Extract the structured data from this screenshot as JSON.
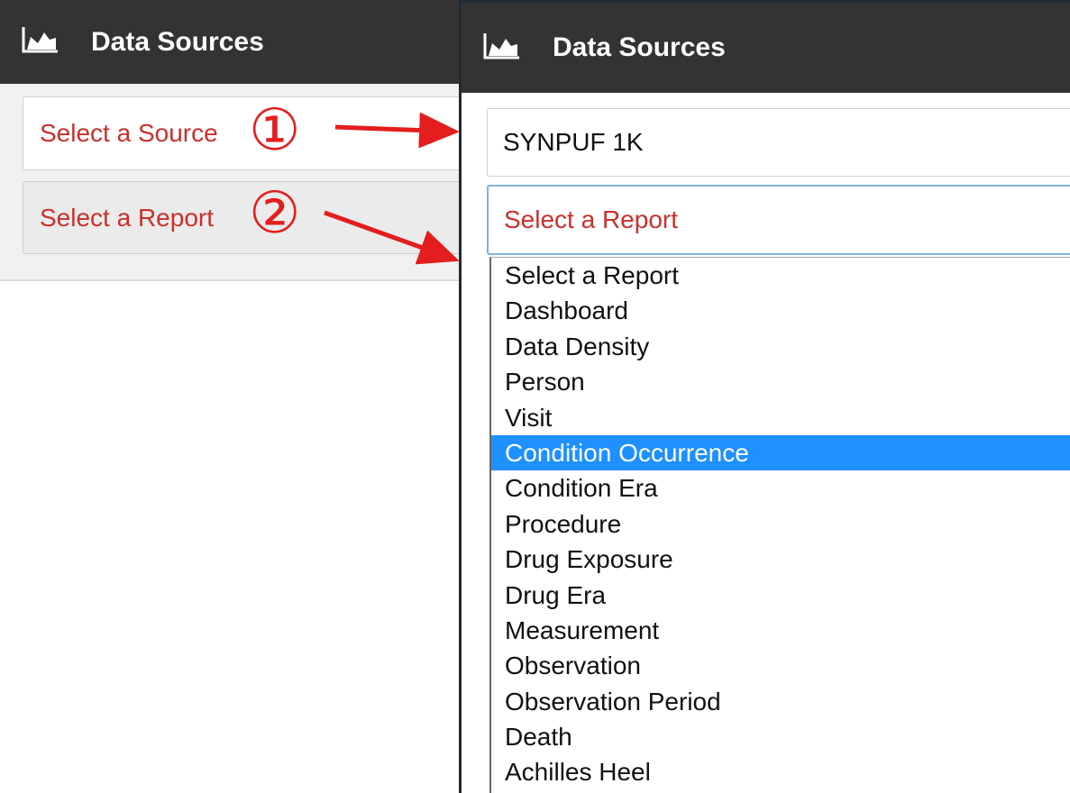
{
  "header": {
    "title": "Data Sources",
    "icon": "area-chart-icon"
  },
  "left": {
    "source_placeholder": "Select a Source",
    "report_placeholder": "Select a Report"
  },
  "right": {
    "source_value": "SYNPUF 1K",
    "report_placeholder": "Select a Report",
    "options": [
      "Select a Report",
      "Dashboard",
      "Data Density",
      "Person",
      "Visit",
      "Condition Occurrence",
      "Condition Era",
      "Procedure",
      "Drug Exposure",
      "Drug Era",
      "Measurement",
      "Observation",
      "Observation Period",
      "Death",
      "Achilles Heel"
    ],
    "selected_option": "Condition Occurrence"
  },
  "annotations": {
    "step1": "①",
    "step2": "②"
  },
  "colors": {
    "header_bg": "#333333",
    "placeholder_red": "#c9302c",
    "annotation_red": "#e41d1d",
    "selection_blue": "#1e90ff"
  }
}
